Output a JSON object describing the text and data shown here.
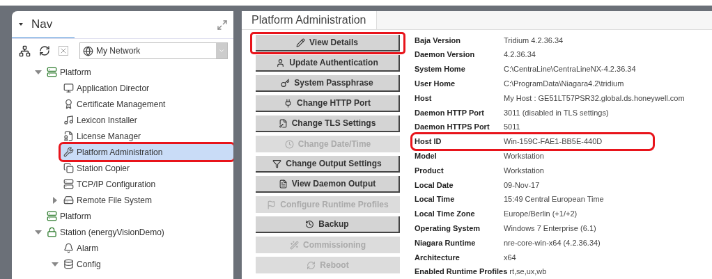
{
  "nav": {
    "title": "Nav",
    "network_selector": {
      "value": "My Network"
    },
    "tree": [
      {
        "label": "Platform",
        "expanded": true,
        "selected": false,
        "highlighted": false,
        "children": [
          {
            "label": "Application Director",
            "selected": false,
            "highlighted": false
          },
          {
            "label": "Certificate Management",
            "selected": false,
            "highlighted": false
          },
          {
            "label": "Lexicon Installer",
            "selected": false,
            "highlighted": false
          },
          {
            "label": "License Manager",
            "selected": false,
            "highlighted": false
          },
          {
            "label": "Platform Administration",
            "selected": true,
            "highlighted": true
          },
          {
            "label": "Station Copier",
            "selected": false,
            "highlighted": false
          },
          {
            "label": "TCP/IP Configuration",
            "selected": false,
            "highlighted": false
          },
          {
            "label": "Remote File System",
            "expanded": false,
            "selected": false,
            "highlighted": false
          }
        ]
      },
      {
        "label": "Platform",
        "selected": false,
        "highlighted": false
      },
      {
        "label": "Station (energyVisionDemo)",
        "expanded": true,
        "selected": false,
        "highlighted": false,
        "children": [
          {
            "label": "Alarm",
            "selected": false,
            "highlighted": false
          },
          {
            "label": "Config",
            "expanded": true,
            "selected": false,
            "highlighted": false
          }
        ]
      }
    ]
  },
  "main": {
    "title": "Platform Administration",
    "buttons": [
      {
        "label": "View Details",
        "disabled": false,
        "highlighted": true
      },
      {
        "label": "Update Authentication",
        "disabled": false,
        "highlighted": false
      },
      {
        "label": "System Passphrase",
        "disabled": false,
        "highlighted": false
      },
      {
        "label": "Change HTTP Port",
        "disabled": false,
        "highlighted": false
      },
      {
        "label": "Change TLS Settings",
        "disabled": false,
        "highlighted": false
      },
      {
        "label": "Change Date/Time",
        "disabled": true,
        "highlighted": false
      },
      {
        "label": "Change Output Settings",
        "disabled": false,
        "highlighted": false
      },
      {
        "label": "View Daemon Output",
        "disabled": false,
        "highlighted": false
      },
      {
        "label": "Configure Runtime Profiles",
        "disabled": true,
        "highlighted": false
      },
      {
        "label": "Backup",
        "disabled": false,
        "highlighted": false
      },
      {
        "label": "Commissioning",
        "disabled": true,
        "highlighted": false
      },
      {
        "label": "Reboot",
        "disabled": true,
        "highlighted": false
      }
    ],
    "details": [
      {
        "label": "Baja Version",
        "value": "Tridium 4.2.36.34",
        "highlighted": false
      },
      {
        "label": "Daemon Version",
        "value": "4.2.36.34",
        "highlighted": false
      },
      {
        "label": "System Home",
        "value": "C:\\CentraLine\\CentraLineNX-4.2.36.34",
        "highlighted": false
      },
      {
        "label": "User Home",
        "value": "C:\\ProgramData\\Niagara4.2\\tridium",
        "highlighted": false
      },
      {
        "label": "Host",
        "value": "My Host : GE51LT57PSR32.global.ds.honeywell.com",
        "highlighted": false
      },
      {
        "label": "Daemon HTTP Port",
        "value": "3011 (disabled in TLS settings)",
        "highlighted": false
      },
      {
        "label": "Daemon HTTPS Port",
        "value": "5011",
        "highlighted": false
      },
      {
        "label": "Host ID",
        "value": "Win-159C-FAE1-BB5E-440D",
        "highlighted": true
      },
      {
        "label": "Model",
        "value": "Workstation",
        "highlighted": false
      },
      {
        "label": "Product",
        "value": "Workstation",
        "highlighted": false
      },
      {
        "label": "Local Date",
        "value": "09-Nov-17",
        "highlighted": false
      },
      {
        "label": "Local Time",
        "value": "15:49 Central European Time",
        "highlighted": false
      },
      {
        "label": "Local Time Zone",
        "value": "Europe/Berlin (+1/+2)",
        "highlighted": false
      },
      {
        "label": "Operating System",
        "value": "Windows 7 Enterprise (6.1)",
        "highlighted": false
      },
      {
        "label": "Niagara Runtime",
        "value": "nre-core-win-x64 (4.2.36.34)",
        "highlighted": false
      },
      {
        "label": "Architecture",
        "value": "x64",
        "highlighted": false
      },
      {
        "label": "Enabled Runtime Profiles",
        "value": "rt,se,ux,wb",
        "highlighted": false
      }
    ]
  }
}
